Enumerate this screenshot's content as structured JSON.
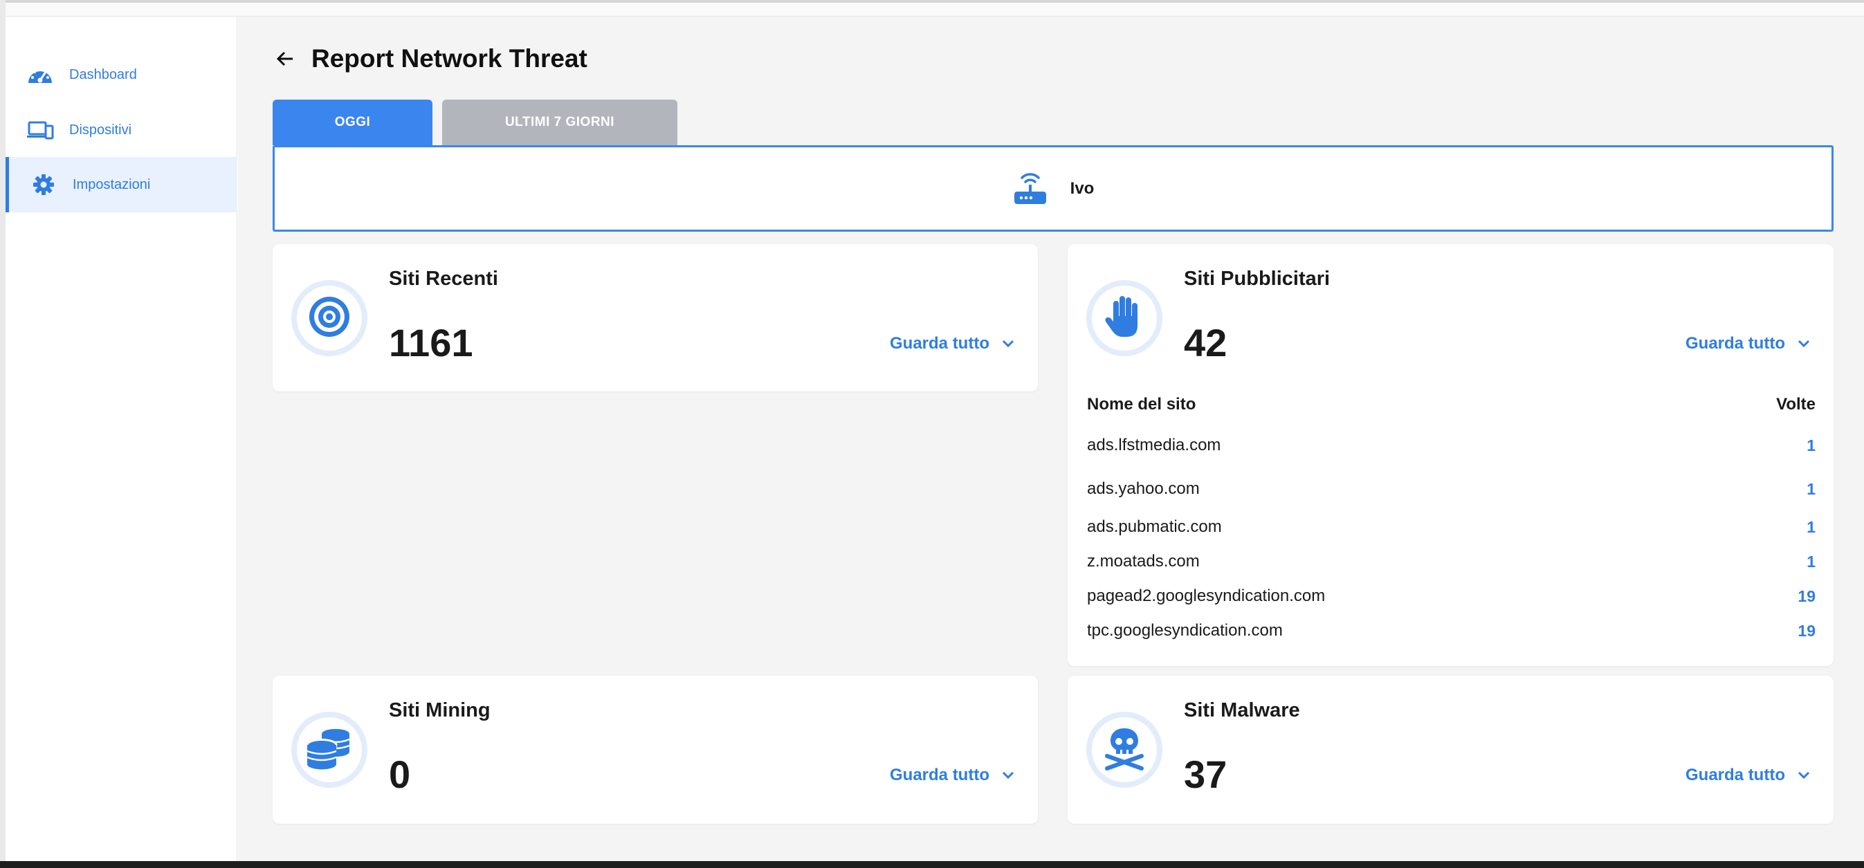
{
  "colors": {
    "accent": "#3b86ee",
    "tab_inactive": "#b3b5bd",
    "link": "#2f7de1",
    "icon_ring": "#e3ecfb",
    "background": "#f4f4f4"
  },
  "sidebar": {
    "items": [
      {
        "label": "Dashboard",
        "icon": "speedometer-icon",
        "active": false
      },
      {
        "label": "Dispositivi",
        "icon": "devices-icon",
        "active": false
      },
      {
        "label": "Impostazioni",
        "icon": "gear-icon",
        "active": true
      }
    ]
  },
  "header": {
    "title": "Report Network Threat",
    "back_icon": "arrow-left-icon"
  },
  "tabs": [
    {
      "label": "OGGI",
      "active": true
    },
    {
      "label": "ULTIMI 7 GIORNI",
      "active": false
    }
  ],
  "device": {
    "name": "Ivo",
    "icon": "router-icon"
  },
  "cards": {
    "recent": {
      "title": "Siti Recenti",
      "count": "1161",
      "see_all": "Guarda tutto",
      "icon": "target-icon"
    },
    "ads": {
      "title": "Siti Pubblicitari",
      "count": "42",
      "see_all": "Guarda tutto",
      "icon": "hand-stop-icon",
      "table": {
        "col_site": "Nome del sito",
        "col_times": "Volte",
        "rows": [
          {
            "site": "ads.lfstmedia.com",
            "times": "1"
          },
          {
            "site": "ads.yahoo.com",
            "times": "1"
          },
          {
            "site": "ads.pubmatic.com",
            "times": "1"
          },
          {
            "site": "z.moatads.com",
            "times": "1"
          },
          {
            "site": "pagead2.googlesyndication.com",
            "times": "19"
          },
          {
            "site": "tpc.googlesyndication.com",
            "times": "19"
          }
        ]
      }
    },
    "mining": {
      "title": "Siti Mining",
      "count": "0",
      "see_all": "Guarda tutto",
      "icon": "coins-icon"
    },
    "malware": {
      "title": "Siti Malware",
      "count": "37",
      "see_all": "Guarda tutto",
      "icon": "skull-crossbones-icon"
    }
  }
}
